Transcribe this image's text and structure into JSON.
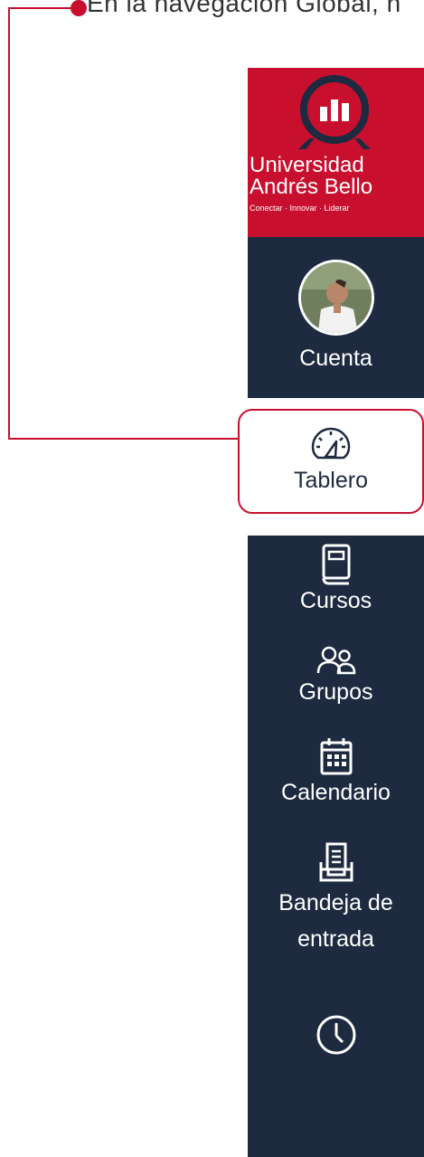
{
  "callout": {
    "text": "En la navegación Global, h"
  },
  "logo": {
    "line1": "Universidad",
    "line2": "Andrés Bello",
    "tagline": "Conectar · Innovar · Liderar"
  },
  "nav": {
    "items": [
      {
        "label": "Cuenta",
        "icon": "avatar"
      },
      {
        "label": "Tablero",
        "icon": "dashboard-gauge-icon"
      },
      {
        "label": "Cursos",
        "icon": "book-icon"
      },
      {
        "label": "Grupos",
        "icon": "people-icon"
      },
      {
        "label": "Calendario",
        "icon": "calendar-icon"
      },
      {
        "label": "Bandeja de",
        "label2": "entrada",
        "icon": "inbox-icon"
      },
      {
        "label": "",
        "icon": "clock-icon"
      }
    ]
  },
  "colors": {
    "brand_red": "#c8102e",
    "sidebar_navy": "#1d2a3f",
    "white": "#ffffff"
  }
}
